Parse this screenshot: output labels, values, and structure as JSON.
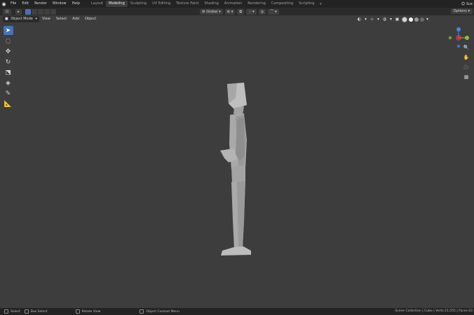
{
  "menubar": {
    "items": [
      "File",
      "Edit",
      "Render",
      "Window",
      "Help"
    ]
  },
  "workspaces": {
    "tabs": [
      "Layout",
      "Modeling",
      "Sculpting",
      "UV Editing",
      "Texture Paint",
      "Shading",
      "Animation",
      "Rendering",
      "Compositing",
      "Scripting"
    ],
    "active": "Modeling",
    "add": "+"
  },
  "scene": {
    "label": "Sce"
  },
  "header": {
    "orientation": "Global",
    "options": "Options"
  },
  "viewport_header": {
    "mode": "Object Mode",
    "menus": [
      "View",
      "Select",
      "Add",
      "Object"
    ]
  },
  "gizmo": {
    "z_label": "Z",
    "y_label": "Y",
    "x_label": "X"
  },
  "statusbar": {
    "select": "Select",
    "box_select": "Box Select",
    "rotate_view": "Rotate View",
    "context_menu": "Object Context Menu",
    "stats": "Scene Collection | Cube | Verts:21,555 | Faces:43"
  },
  "colors": {
    "accent": "#4772b3",
    "axis_x": "#e8404f",
    "axis_y": "#8ac23b",
    "axis_z": "#3e8ae2"
  }
}
